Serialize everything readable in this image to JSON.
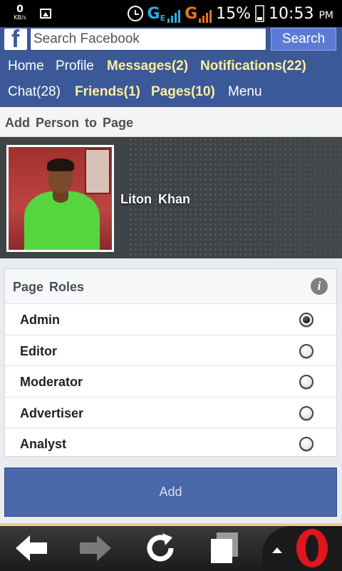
{
  "status_bar": {
    "speed_value": "0",
    "speed_unit": "KB/s",
    "network_g1": "G",
    "network_e": "E",
    "network_g2": "G",
    "battery_percent": "15%",
    "time": "10:53",
    "ampm": "PM"
  },
  "header": {
    "logo_letter": "f",
    "search_placeholder": "Search Facebook",
    "search_button": "Search",
    "nav_row1": [
      "Home",
      "Profile",
      "Messages(2)",
      "Notifications(22)"
    ],
    "nav_row2": [
      "Chat(28)",
      "Friends(1)",
      "Pages(10)",
      "Menu"
    ]
  },
  "page_title": "Add Person to Page",
  "person": {
    "name": "Liton Khan"
  },
  "roles": {
    "title": "Page Roles",
    "info_symbol": "i",
    "items": [
      {
        "label": "Admin",
        "selected": true
      },
      {
        "label": "Editor",
        "selected": false
      },
      {
        "label": "Moderator",
        "selected": false
      },
      {
        "label": "Advertiser",
        "selected": false
      },
      {
        "label": "Analyst",
        "selected": false
      }
    ]
  },
  "add_button": "Add",
  "toolbar": {
    "icons": [
      "back-arrow-icon",
      "forward-arrow-icon",
      "reload-icon",
      "tabs-icon",
      "opera-logo-icon"
    ]
  },
  "colors": {
    "facebook_blue": "#3b5998",
    "nav_highlight": "#ffef9c",
    "add_button": "#4a67aa",
    "opera_red": "#e0151e"
  }
}
